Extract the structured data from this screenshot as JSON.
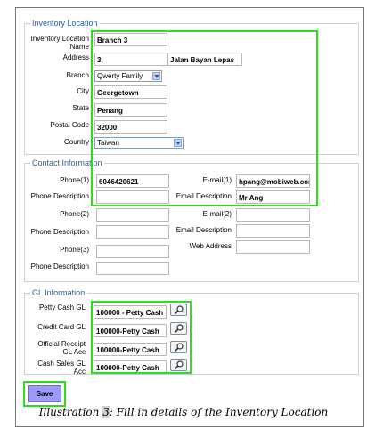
{
  "inventory_location": {
    "legend": "Inventory Location",
    "name_label": "Inventory Location Name",
    "name_value": "Branch 3",
    "address_label": "Address",
    "address1_value": "3,",
    "address2_value": "Jalan Bayan Lepas",
    "branch_label": "Branch",
    "branch_value": "Qwerty Family",
    "city_label": "City",
    "city_value": "Georgetown",
    "state_label": "State",
    "state_value": "Penang",
    "postal_label": "Postal Code",
    "postal_value": "32000",
    "country_label": "Country",
    "country_value": "Taiwan"
  },
  "contact": {
    "legend": "Contact Information",
    "phone1_label": "Phone(1)",
    "phone1_value": "6046420621",
    "phone_desc1_label": "Phone Description",
    "phone_desc1_value": "",
    "phone2_label": "Phone(2)",
    "phone2_value": "",
    "phone_desc2_label": "Phone Description",
    "phone_desc2_value": "",
    "phone3_label": "Phone(3)",
    "phone3_value": "",
    "phone_desc3_label": "Phone Description",
    "phone_desc3_value": "",
    "email1_label": "E-mail(1)",
    "email1_value": "hpang@mobiweb.com",
    "email_desc1_label": "Email Description",
    "email_desc1_value": "Mr Ang",
    "email2_label": "E-mail(2)",
    "email2_value": "",
    "email_desc2_label": "Email Description",
    "email_desc2_value": "",
    "web_label": "Web Address",
    "web_value": ""
  },
  "gl": {
    "legend": "GL Information",
    "petty_label": "Petty Cash GL",
    "petty_value": "100000 - Petty Cash",
    "credit_label": "Credit Card GL",
    "credit_value": "100000-Petty Cash",
    "official_label": "Official Receipt GL Acc",
    "official_value": "100000-Petty Cash",
    "cashsales_label": "Cash Sales GL Acc",
    "cashsales_value": "100000-Petty Cash"
  },
  "actions": {
    "save_label": "Save"
  },
  "caption": {
    "prefix": "Illustration ",
    "number": "3",
    "suffix": ": Fill in details of the Inventory Location"
  },
  "colors": {
    "highlight": "#28e01d",
    "legend_text": "#2f5f9a",
    "save_button": "#9b9bff"
  }
}
